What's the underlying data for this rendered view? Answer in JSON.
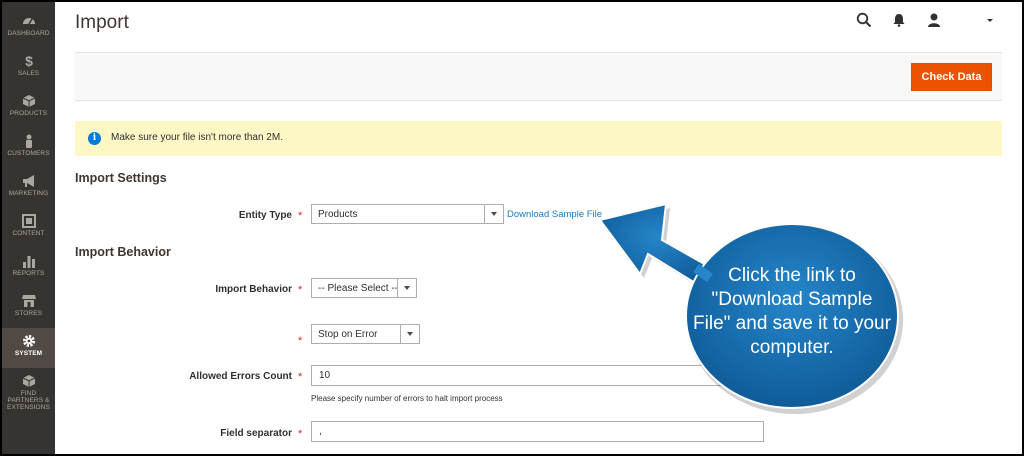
{
  "sidebar": {
    "items": [
      {
        "label": "DASHBOARD",
        "icon": "dashboard-icon"
      },
      {
        "label": "SALES",
        "icon": "dollar-icon"
      },
      {
        "label": "PRODUCTS",
        "icon": "cube-icon"
      },
      {
        "label": "CUSTOMERS",
        "icon": "person-icon"
      },
      {
        "label": "MARKETING",
        "icon": "megaphone-icon"
      },
      {
        "label": "CONTENT",
        "icon": "layout-icon"
      },
      {
        "label": "REPORTS",
        "icon": "bar-chart-icon"
      },
      {
        "label": "STORES",
        "icon": "storefront-icon"
      },
      {
        "label": "SYSTEM",
        "icon": "gear-icon"
      },
      {
        "label": "FIND PARTNERS & EXTENSIONS",
        "icon": "boxes-icon"
      }
    ],
    "active": "SYSTEM"
  },
  "header": {
    "title": "Import"
  },
  "actions": {
    "check_data": "Check Data"
  },
  "message": {
    "text": "Make sure your file isn't more than 2M."
  },
  "import_settings": {
    "title": "Import Settings",
    "entity_type_label": "Entity Type",
    "entity_type_value": "Products",
    "download_link": "Download Sample File"
  },
  "import_behavior": {
    "title": "Import Behavior",
    "behavior_label": "Import Behavior",
    "behavior_value": "-- Please Select --",
    "error_mode_value": "Stop on Error",
    "allowed_errors_label": "Allowed Errors Count",
    "allowed_errors_value": "10",
    "allowed_errors_note": "Please specify number of errors to halt import process",
    "field_separator_label": "Field separator",
    "field_separator_value": ","
  },
  "callout": {
    "text": "Click the link to \"Download Sample File\" and save it to your computer."
  },
  "colors": {
    "sidebar_bg": "#373330",
    "sidebar_active": "#514943",
    "primary_button": "#eb5202",
    "message_bg": "#fdf7c6",
    "link": "#1979c3",
    "callout": "#1569a9"
  }
}
